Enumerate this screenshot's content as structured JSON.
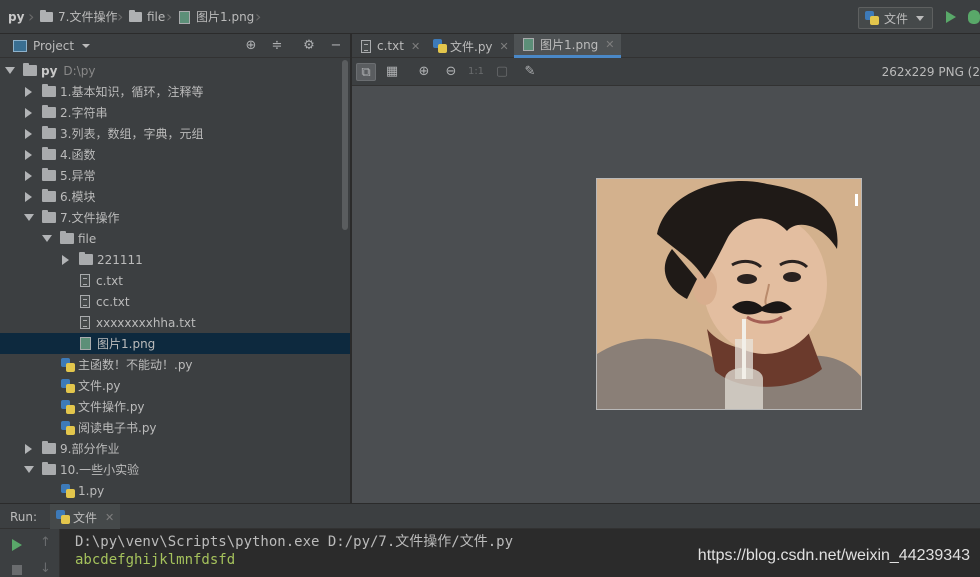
{
  "navbar": {
    "crumbs": [
      "py",
      "7.文件操作",
      "file",
      "图片1.png"
    ],
    "run_config": "文件"
  },
  "project": {
    "title": "Project",
    "tree": [
      {
        "label": "py",
        "hint": "D:\\py"
      },
      {
        "label": "1.基本知识，循环，注释等"
      },
      {
        "label": "2.字符串"
      },
      {
        "label": "3.列表，数组，字典，元组"
      },
      {
        "label": "4.函数"
      },
      {
        "label": "5.异常"
      },
      {
        "label": "6.模块"
      },
      {
        "label": "7.文件操作"
      },
      {
        "label": "file"
      },
      {
        "label": "221111"
      },
      {
        "label": "c.txt"
      },
      {
        "label": "cc.txt"
      },
      {
        "label": "xxxxxxxxhha.txt"
      },
      {
        "label": "图片1.png"
      },
      {
        "label": "主函数！不能动！.py"
      },
      {
        "label": "文件.py"
      },
      {
        "label": "文件操作.py"
      },
      {
        "label": "阅读电子书.py"
      },
      {
        "label": "9.部分作业"
      },
      {
        "label": "10.一些小实验"
      },
      {
        "label": "1.py"
      }
    ]
  },
  "tabs": [
    "c.txt",
    "文件.py",
    "图片1.png"
  ],
  "viewer": {
    "info": "262x229 PNG (2"
  },
  "run": {
    "label": "Run:",
    "tab": "文件",
    "lines": [
      "D:\\py\\venv\\Scripts\\python.exe D:/py/7.文件操作/文件.py",
      "abcdefghijklmnfdsfd"
    ],
    "watermark": "https://blog.csdn.net/weixin_44239343"
  },
  "colors": {
    "accent": "#4a88c7",
    "selected_row": "#0d293e",
    "run_green": "#59a869",
    "output_green": "#a5c25c"
  }
}
